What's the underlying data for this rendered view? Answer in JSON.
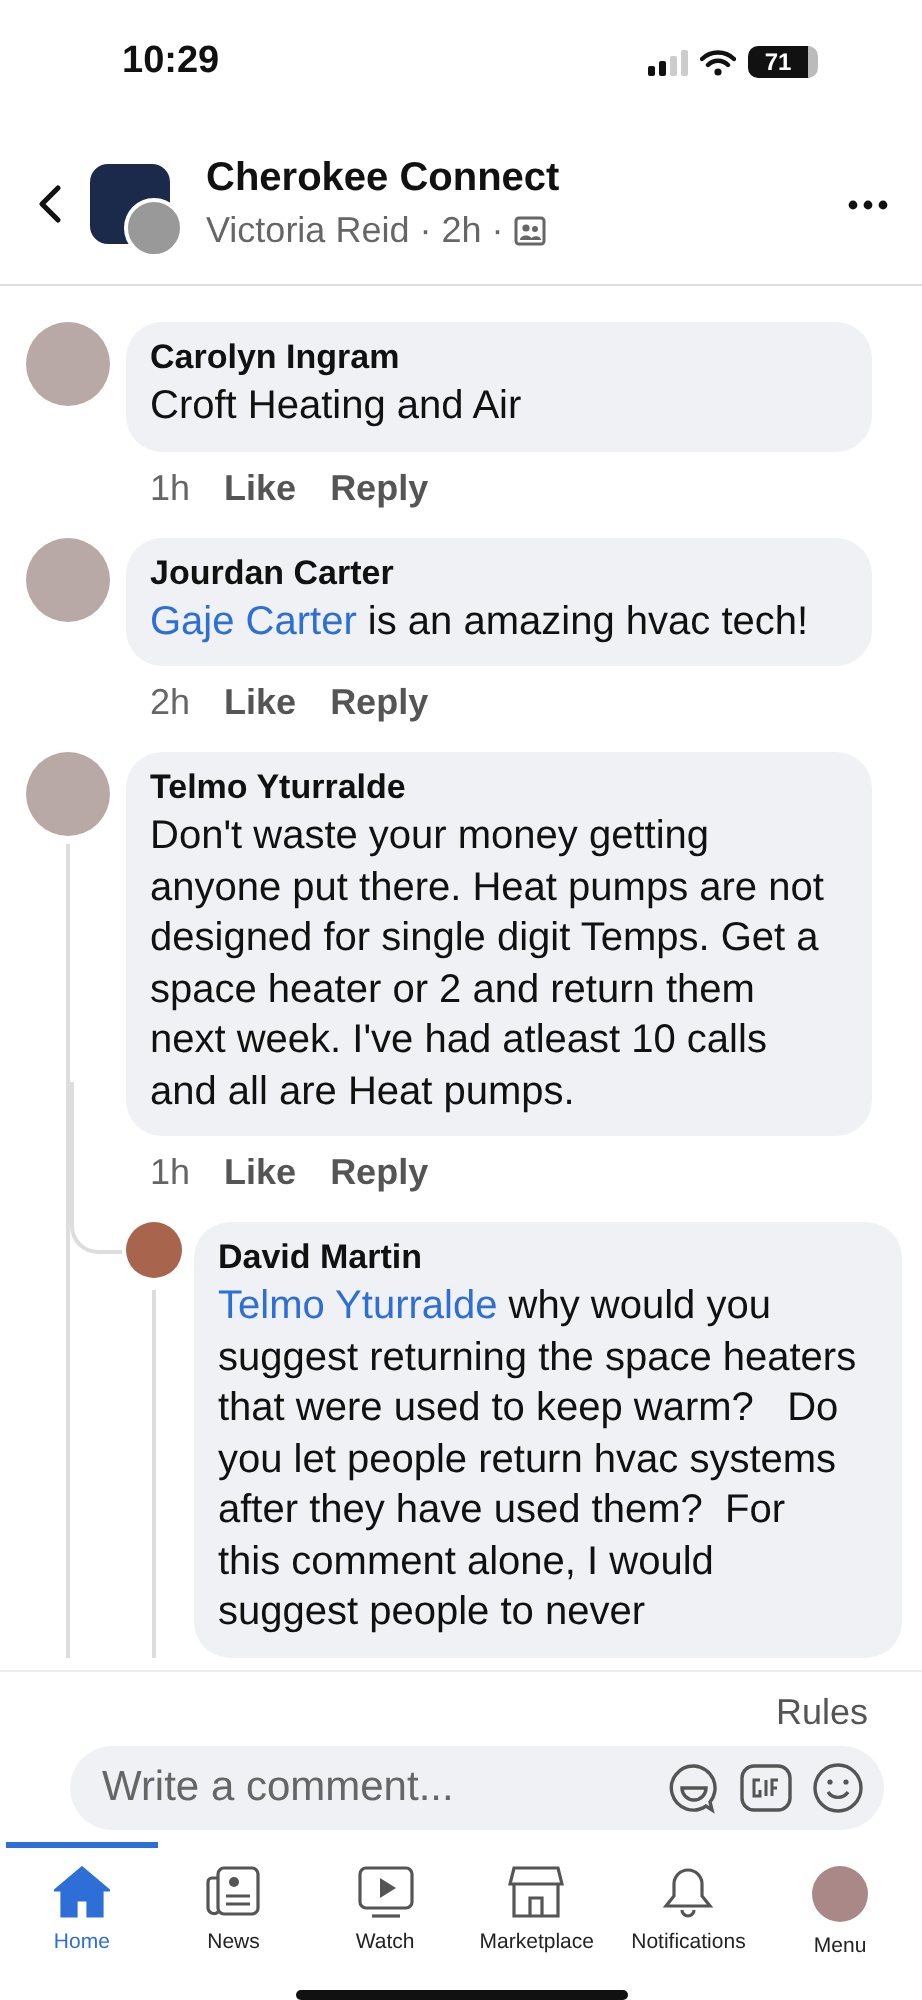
{
  "status_bar": {
    "time": "10:29",
    "battery": "71"
  },
  "header": {
    "title": "Cherokee Connect",
    "byline": "Victoria Reid · 2h ·"
  },
  "comments": [
    {
      "author": "Carolyn Ingram",
      "text": "Croft Heating and Air",
      "time": "1h",
      "like": "Like",
      "reply": "Reply"
    },
    {
      "author": "Jourdan Carter",
      "mention": "Gaje Carter",
      "text": " is an amazing hvac tech!",
      "time": "2h",
      "like": "Like",
      "reply": "Reply"
    },
    {
      "author": "Telmo Yturralde",
      "text": "Don't waste your money getting anyone put there. Heat pumps are not designed for single digit Temps. Get a space heater or 2 and return them next week. I've had atleast 10 calls and all are Heat pumps.",
      "time": "1h",
      "like": "Like",
      "reply": "Reply",
      "replies": [
        {
          "author": "David Martin",
          "mention": "Telmo Yturralde",
          "text": " why would you suggest returning the space heaters that were used to keep warm?   Do you let people return hvac systems after they have used them?  For this comment alone, I would suggest people to never"
        }
      ]
    }
  ],
  "rules": "Rules",
  "composer": {
    "placeholder": "Write a comment..."
  },
  "nav": [
    {
      "kind": "home",
      "label": "Home",
      "selected": true
    },
    {
      "kind": "news",
      "label": "News",
      "selected": false
    },
    {
      "kind": "watch",
      "label": "Watch",
      "selected": false
    },
    {
      "kind": "marketplace",
      "label": "Marketplace",
      "selected": false
    },
    {
      "kind": "notifications",
      "label": "Notifications",
      "selected": false
    },
    {
      "kind": "menu",
      "label": "Menu",
      "selected": false
    }
  ]
}
